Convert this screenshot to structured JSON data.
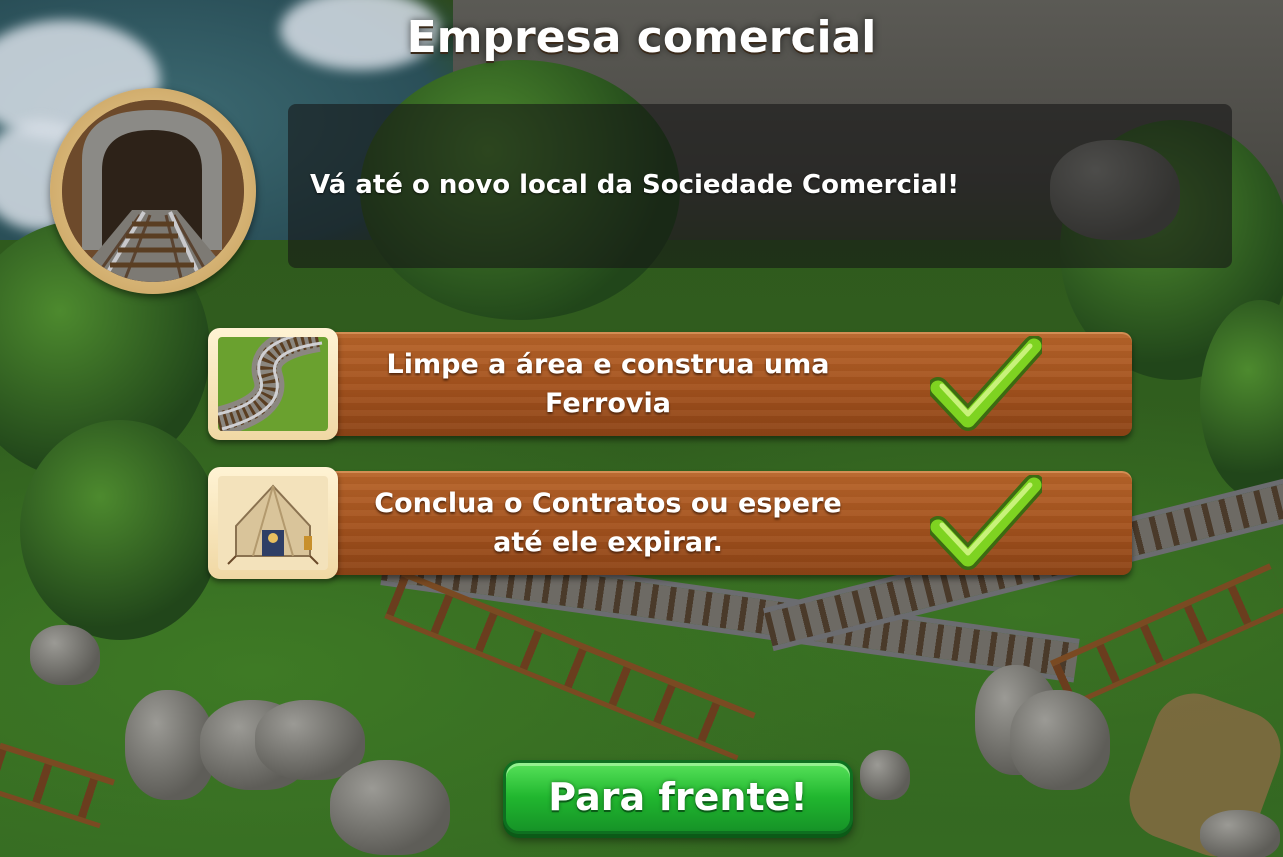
{
  "dialog": {
    "title": "Empresa comercial",
    "portrait_icon": "mine-tunnel-icon",
    "description": "Vá até o novo local da Sociedade Comercial!",
    "tasks": [
      {
        "icon": "railway-track-icon",
        "label": "Limpe a área e construa uma Ferrovia",
        "status_icon": "checkmark-icon",
        "completed": true
      },
      {
        "icon": "merchant-tent-icon",
        "label": "Conclua o Contratos ou espere até ele expirar.",
        "status_icon": "checkmark-icon",
        "completed": true
      }
    ],
    "continue_label": "Para frente!"
  },
  "colors": {
    "plank": "#a5531e",
    "button_green": "#21b72f",
    "check_green": "#7ed321",
    "frame_cream": "#f0d8a4"
  }
}
